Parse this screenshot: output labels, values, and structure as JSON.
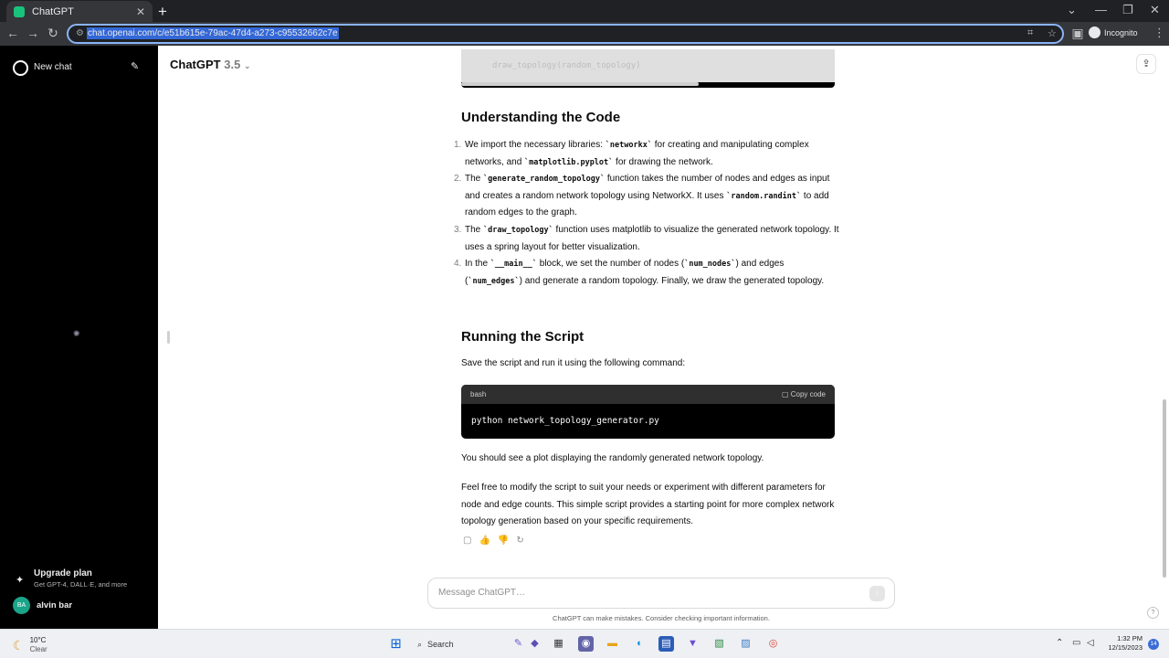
{
  "browser": {
    "tab_title": "ChatGPT",
    "tab_close": "✕",
    "new_tab": "+",
    "url": "chat.openai.com/c/e51b615e-79ac-47d4-a273-c95532662c7e",
    "incognito_label": "Incognito"
  },
  "sidebar": {
    "new_chat": "New chat",
    "upgrade_title": "Upgrade plan",
    "upgrade_subtitle": "Get GPT-4, DALL·E, and more",
    "user_initials": "BA",
    "user_name": "alvin bar"
  },
  "header": {
    "model_name": "ChatGPT",
    "model_version": "3.5"
  },
  "content": {
    "prev_code_line": "draw_topology(random_topology)",
    "section1_title": "Understanding the Code",
    "list": [
      {
        "num": "1.",
        "t1": "We import the necessary libraries: ",
        "c1": "`networkx`",
        "t2": " for creating and manipulating complex networks, and ",
        "c2": "`matplotlib.pyplot`",
        "t3": " for drawing the network."
      },
      {
        "num": "2.",
        "t1": "The ",
        "c1": "`generate_random_topology`",
        "t2": " function takes the number of nodes and edges as input and creates a random network topology using NetworkX. It uses ",
        "c2": "`random.randint`",
        "t3": " to add random edges to the graph."
      },
      {
        "num": "3.",
        "t1": "The ",
        "c1": "`draw_topology`",
        "t2": " function uses matplotlib to visualize the generated network topology. It uses a spring layout for better visualization.",
        "c2": "",
        "t3": ""
      },
      {
        "num": "4.",
        "t1": "In the ",
        "c1": "`__main__`",
        "t2": " block, we set the number of nodes (",
        "c2": "`num_nodes`",
        "t3": ") and edges (",
        "c3": "`num_edges`",
        "t4": ") and generate a random topology. Finally, we draw the generated topology."
      }
    ],
    "section2_title": "Running the Script",
    "run_intro": "Save the script and run it using the following command:",
    "code_lang": "bash",
    "copy_code": "Copy code",
    "command": "python network_topology_generator.py",
    "result_text": "You should see a plot displaying the randomly generated network topology.",
    "closing_text": "Feel free to modify the script to suit your needs or experiment with different parameters for node and edge counts. This simple script provides a starting point for more complex network topology generation based on your specific requirements."
  },
  "composer": {
    "placeholder": "Message ChatGPT…",
    "disclaimer": "ChatGPT can make mistakes. Consider checking important information."
  },
  "taskbar": {
    "temperature": "10°C",
    "weather": "Clear",
    "search_label": "Search",
    "time": "1:32 PM",
    "date": "12/15/2023",
    "notifications": "14"
  }
}
